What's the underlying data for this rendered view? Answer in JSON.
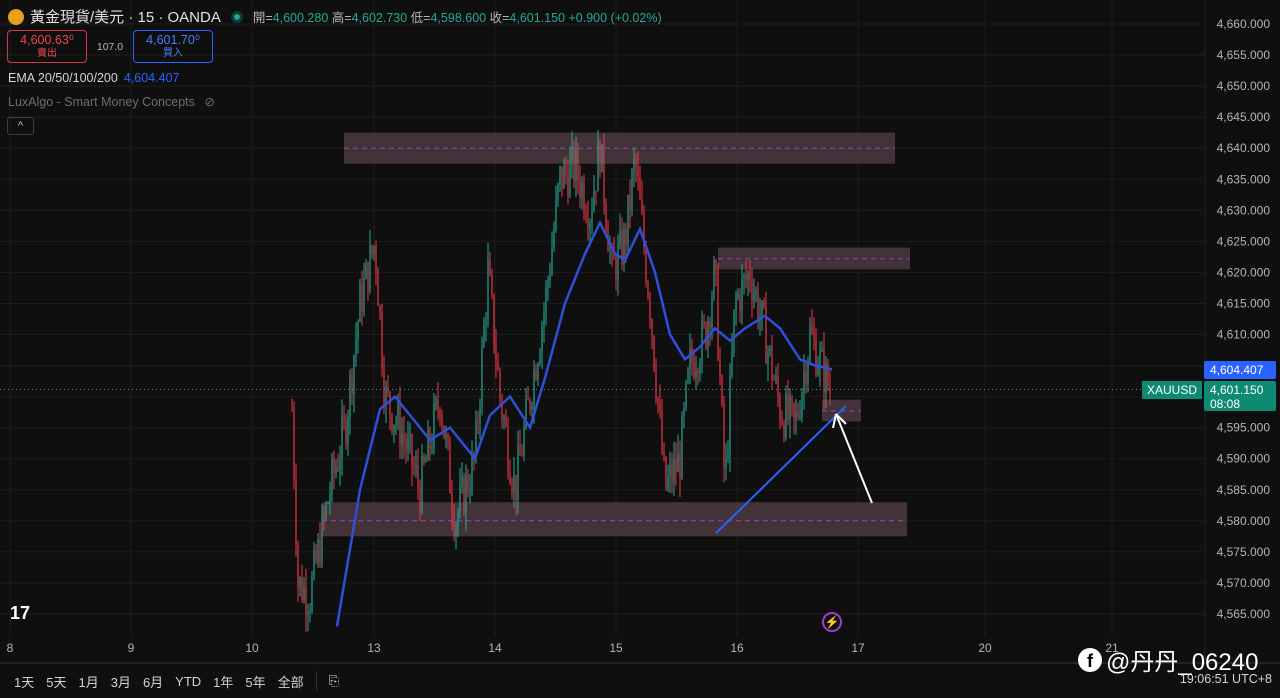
{
  "header": {
    "symbol": "黃金現貨/美元 · 15 · OANDA",
    "open_label": "開=",
    "open": "4,600.280",
    "high_label": "高=",
    "high": "4,602.730",
    "low_label": "低=",
    "low": "4,598.600",
    "close_label": "收=",
    "close": "4,601.150",
    "change": "+0.900 (+0.02%)"
  },
  "trade": {
    "sell_price": "4,600.63⁰",
    "sell_label": "賣出",
    "spread": "107.0",
    "buy_price": "4,601.70⁰",
    "buy_label": "買入"
  },
  "indicators": {
    "ema_label": "EMA 20/50/100/200",
    "ema_value": "4,604.407",
    "lux_label": "LuxAlgo - Smart Money Concepts",
    "collapse": "^"
  },
  "price_axis": {
    "ema_tag": "4,604.407",
    "symbol_tag": "XAUUSD",
    "current": "4,601.150",
    "countdown": "08:08"
  },
  "bottom": {
    "ranges": [
      "1天",
      "5天",
      "1月",
      "3月",
      "6月",
      "YTD",
      "1年",
      "5年",
      "全部"
    ],
    "time": "19:06:51 UTC+8"
  },
  "watermark": "@丹丹_06240",
  "colors": {
    "up": "#22ab94",
    "down": "#f23645",
    "ema": "#2f4fd8",
    "zone": "#4a3a40"
  },
  "chart_data": {
    "type": "candlestick",
    "ylim": [
      4562,
      4662
    ],
    "yticks": [
      "4,565.000",
      "4,570.000",
      "4,575.000",
      "4,580.000",
      "4,585.000",
      "4,590.000",
      "4,595.000",
      "4,600.000",
      "4,605.000",
      "4,610.000",
      "4,615.000",
      "4,620.000",
      "4,625.000",
      "4,630.000",
      "4,635.000",
      "4,640.000",
      "4,645.000",
      "4,650.000",
      "4,655.000",
      "4,660.000"
    ],
    "xticks": [
      "8",
      "9",
      "10",
      "13",
      "14",
      "15",
      "16",
      "17",
      "20",
      "21"
    ],
    "price_path": [
      4598,
      4570,
      4568,
      4585,
      4595,
      4615,
      4625,
      4600,
      4595,
      4585,
      4600,
      4580,
      4590,
      4620,
      4600,
      4585,
      4600,
      4615,
      4635,
      4637,
      4630,
      4640,
      4620,
      4625,
      4638,
      4615,
      4585,
      4590,
      4605,
      4610,
      4620,
      4585,
      4615,
      4620,
      4610,
      4598,
      4595,
      4610,
      4601
    ],
    "ema_path": [
      4563,
      4585,
      4598,
      4600,
      4597,
      4593,
      4595,
      4590,
      4597,
      4600,
      4595,
      4603,
      4615,
      4623,
      4628,
      4623,
      4622,
      4627,
      4620,
      4610,
      4606,
      4608,
      4611,
      4609,
      4611,
      4613,
      4611,
      4606,
      4605,
      4604.4
    ],
    "zones": [
      {
        "from": 4637.5,
        "to": 4642.5,
        "mid": 4640
      },
      {
        "from": 4620.5,
        "to": 4624,
        "mid": 4622.2
      },
      {
        "from": 4596,
        "to": 4599.5,
        "mid": 4597.7
      },
      {
        "from": 4577.5,
        "to": 4583,
        "mid": 4580
      }
    ],
    "trendline": [
      4578,
      4598.5
    ]
  }
}
